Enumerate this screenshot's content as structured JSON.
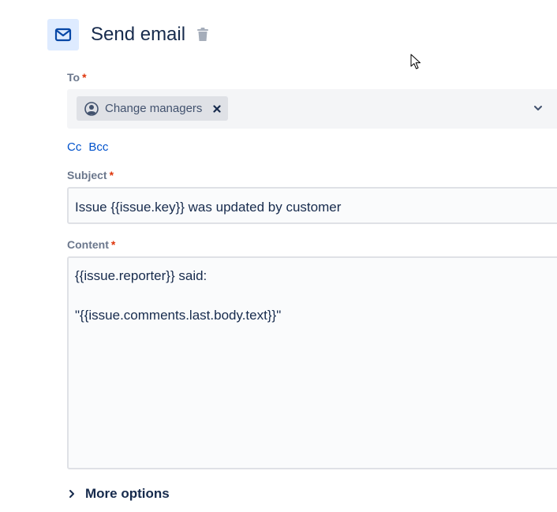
{
  "header": {
    "title": "Send email",
    "icon": "mail-icon",
    "delete_icon": "trash-icon"
  },
  "to": {
    "label": "To",
    "required_mark": "*",
    "recipients": [
      {
        "label": "Change managers",
        "icon": "user-circle-icon",
        "remove_icon": "close-icon"
      }
    ],
    "dropdown_icon": "chevron-down-icon"
  },
  "links": {
    "cc": "Cc",
    "bcc": "Bcc"
  },
  "subject": {
    "label": "Subject",
    "required_mark": "*",
    "value": "Issue {{issue.key}} was updated by customer"
  },
  "content": {
    "label": "Content",
    "required_mark": "*",
    "lines": [
      "{{issue.reporter}} said:",
      "",
      "\"{{issue.comments.last.body.text}}\""
    ]
  },
  "more_options": {
    "label": "More options",
    "icon": "chevron-right-icon"
  },
  "colors": {
    "accent": "#0052cc",
    "icon_bg": "#deebff",
    "required": "#de350b"
  }
}
